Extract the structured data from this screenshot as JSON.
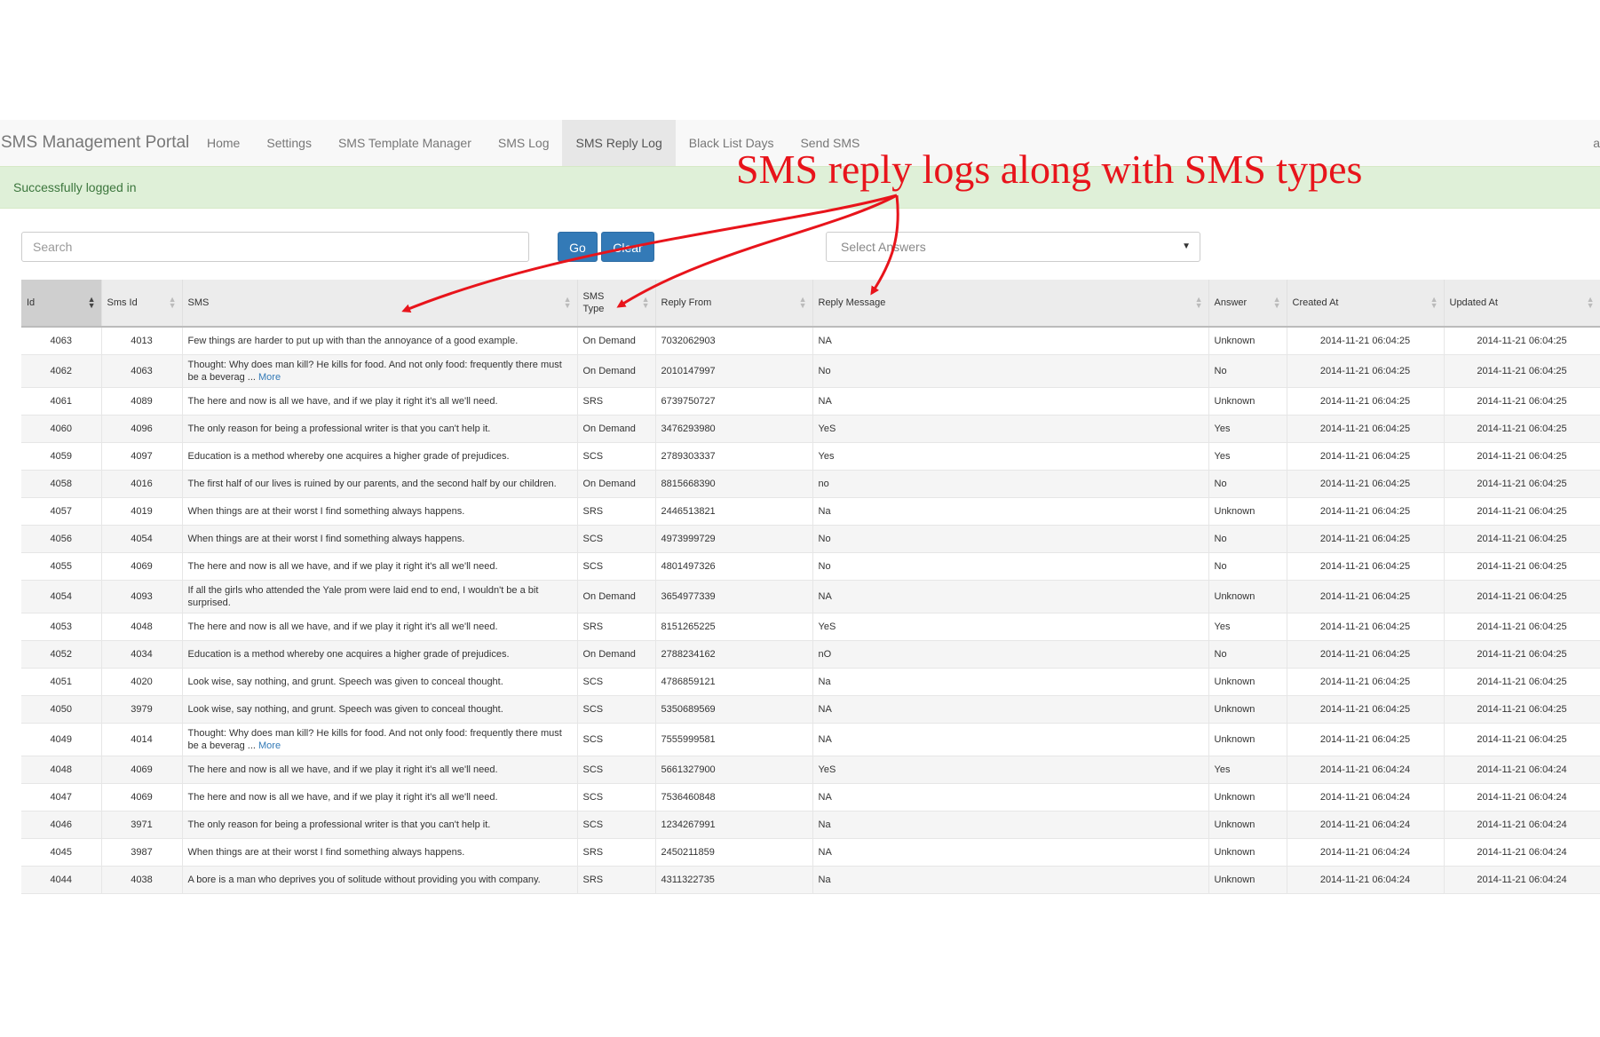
{
  "navbar": {
    "brand": "SMS Management Portal",
    "items": [
      {
        "label": "Home",
        "active": false
      },
      {
        "label": "Settings",
        "active": false
      },
      {
        "label": "SMS Template Manager",
        "active": false
      },
      {
        "label": "SMS Log",
        "active": false
      },
      {
        "label": "SMS Reply Log",
        "active": true
      },
      {
        "label": "Black List Days",
        "active": false
      },
      {
        "label": "Send SMS",
        "active": false
      }
    ],
    "right_text": "a"
  },
  "alert": {
    "message": "Successfully logged in"
  },
  "search": {
    "placeholder": "Search",
    "go_label": "Go",
    "clear_label": "Clear"
  },
  "answer_filter": {
    "placeholder": "Select Answers"
  },
  "annotation": {
    "text": "SMS reply logs along with SMS types",
    "color": "#e8141b"
  },
  "table": {
    "columns": [
      "Id",
      "Sms Id",
      "SMS",
      "SMS Type",
      "Reply From",
      "Reply Message",
      "Answer",
      "Created At",
      "Updated At"
    ],
    "more_label": "More",
    "rows": [
      {
        "id": "4063",
        "sms_id": "4013",
        "sms": "Few things are harder to put up with than the annoyance of a good example.",
        "more": false,
        "type": "On Demand",
        "from": "7032062903",
        "reply": "NA",
        "answer": "Unknown",
        "created": "2014-11-21 06:04:25",
        "updated": "2014-11-21 06:04:25"
      },
      {
        "id": "4062",
        "sms_id": "4063",
        "sms": "Thought: Why does man kill? He kills for food. And not only food: frequently there must be a beverag ...",
        "more": true,
        "type": "On Demand",
        "from": "2010147997",
        "reply": "No",
        "answer": "No",
        "created": "2014-11-21 06:04:25",
        "updated": "2014-11-21 06:04:25"
      },
      {
        "id": "4061",
        "sms_id": "4089",
        "sms": "The here and now is all we have, and if we play it right it's all we'll need.",
        "more": false,
        "type": "SRS",
        "from": "6739750727",
        "reply": "NA",
        "answer": "Unknown",
        "created": "2014-11-21 06:04:25",
        "updated": "2014-11-21 06:04:25"
      },
      {
        "id": "4060",
        "sms_id": "4096",
        "sms": "The only reason for being a professional writer is that you can't help it.",
        "more": false,
        "type": "On Demand",
        "from": "3476293980",
        "reply": "YeS",
        "answer": "Yes",
        "created": "2014-11-21 06:04:25",
        "updated": "2014-11-21 06:04:25"
      },
      {
        "id": "4059",
        "sms_id": "4097",
        "sms": "Education is a method whereby one acquires a higher grade of prejudices.",
        "more": false,
        "type": "SCS",
        "from": "2789303337",
        "reply": "Yes",
        "answer": "Yes",
        "created": "2014-11-21 06:04:25",
        "updated": "2014-11-21 06:04:25"
      },
      {
        "id": "4058",
        "sms_id": "4016",
        "sms": "The first half of our lives is ruined by our parents, and the second half by our children.",
        "more": false,
        "type": "On Demand",
        "from": "8815668390",
        "reply": "no",
        "answer": "No",
        "created": "2014-11-21 06:04:25",
        "updated": "2014-11-21 06:04:25"
      },
      {
        "id": "4057",
        "sms_id": "4019",
        "sms": "When things are at their worst I find something always happens.",
        "more": false,
        "type": "SRS",
        "from": "2446513821",
        "reply": "Na",
        "answer": "Unknown",
        "created": "2014-11-21 06:04:25",
        "updated": "2014-11-21 06:04:25"
      },
      {
        "id": "4056",
        "sms_id": "4054",
        "sms": "When things are at their worst I find something always happens.",
        "more": false,
        "type": "SCS",
        "from": "4973999729",
        "reply": "No",
        "answer": "No",
        "created": "2014-11-21 06:04:25",
        "updated": "2014-11-21 06:04:25"
      },
      {
        "id": "4055",
        "sms_id": "4069",
        "sms": "The here and now is all we have, and if we play it right it's all we'll need.",
        "more": false,
        "type": "SCS",
        "from": "4801497326",
        "reply": "No",
        "answer": "No",
        "created": "2014-11-21 06:04:25",
        "updated": "2014-11-21 06:04:25"
      },
      {
        "id": "4054",
        "sms_id": "4093",
        "sms": "If all the girls who attended the Yale prom were laid end to end, I wouldn't be a bit surprised.",
        "more": false,
        "type": "On Demand",
        "from": "3654977339",
        "reply": "NA",
        "answer": "Unknown",
        "created": "2014-11-21 06:04:25",
        "updated": "2014-11-21 06:04:25"
      },
      {
        "id": "4053",
        "sms_id": "4048",
        "sms": "The here and now is all we have, and if we play it right it's all we'll need.",
        "more": false,
        "type": "SRS",
        "from": "8151265225",
        "reply": "YeS",
        "answer": "Yes",
        "created": "2014-11-21 06:04:25",
        "updated": "2014-11-21 06:04:25"
      },
      {
        "id": "4052",
        "sms_id": "4034",
        "sms": "Education is a method whereby one acquires a higher grade of prejudices.",
        "more": false,
        "type": "On Demand",
        "from": "2788234162",
        "reply": "nO",
        "answer": "No",
        "created": "2014-11-21 06:04:25",
        "updated": "2014-11-21 06:04:25"
      },
      {
        "id": "4051",
        "sms_id": "4020",
        "sms": "Look wise, say nothing, and grunt. Speech was given to conceal thought.",
        "more": false,
        "type": "SCS",
        "from": "4786859121",
        "reply": "Na",
        "answer": "Unknown",
        "created": "2014-11-21 06:04:25",
        "updated": "2014-11-21 06:04:25"
      },
      {
        "id": "4050",
        "sms_id": "3979",
        "sms": "Look wise, say nothing, and grunt. Speech was given to conceal thought.",
        "more": false,
        "type": "SCS",
        "from": "5350689569",
        "reply": "NA",
        "answer": "Unknown",
        "created": "2014-11-21 06:04:25",
        "updated": "2014-11-21 06:04:25"
      },
      {
        "id": "4049",
        "sms_id": "4014",
        "sms": "Thought: Why does man kill? He kills for food. And not only food: frequently there must be a beverag ...",
        "more": true,
        "type": "SCS",
        "from": "7555999581",
        "reply": "NA",
        "answer": "Unknown",
        "created": "2014-11-21 06:04:25",
        "updated": "2014-11-21 06:04:25"
      },
      {
        "id": "4048",
        "sms_id": "4069",
        "sms": "The here and now is all we have, and if we play it right it's all we'll need.",
        "more": false,
        "type": "SCS",
        "from": "5661327900",
        "reply": "YeS",
        "answer": "Yes",
        "created": "2014-11-21 06:04:24",
        "updated": "2014-11-21 06:04:24"
      },
      {
        "id": "4047",
        "sms_id": "4069",
        "sms": "The here and now is all we have, and if we play it right it's all we'll need.",
        "more": false,
        "type": "SCS",
        "from": "7536460848",
        "reply": "NA",
        "answer": "Unknown",
        "created": "2014-11-21 06:04:24",
        "updated": "2014-11-21 06:04:24"
      },
      {
        "id": "4046",
        "sms_id": "3971",
        "sms": "The only reason for being a professional writer is that you can't help it.",
        "more": false,
        "type": "SCS",
        "from": "1234267991",
        "reply": "Na",
        "answer": "Unknown",
        "created": "2014-11-21 06:04:24",
        "updated": "2014-11-21 06:04:24"
      },
      {
        "id": "4045",
        "sms_id": "3987",
        "sms": "When things are at their worst I find something always happens.",
        "more": false,
        "type": "SRS",
        "from": "2450211859",
        "reply": "NA",
        "answer": "Unknown",
        "created": "2014-11-21 06:04:24",
        "updated": "2014-11-21 06:04:24"
      },
      {
        "id": "4044",
        "sms_id": "4038",
        "sms": "A bore is a man who deprives you of solitude without providing you with company.",
        "more": false,
        "type": "SRS",
        "from": "4311322735",
        "reply": "Na",
        "answer": "Unknown",
        "created": "2014-11-21 06:04:24",
        "updated": "2014-11-21 06:04:24"
      }
    ]
  }
}
